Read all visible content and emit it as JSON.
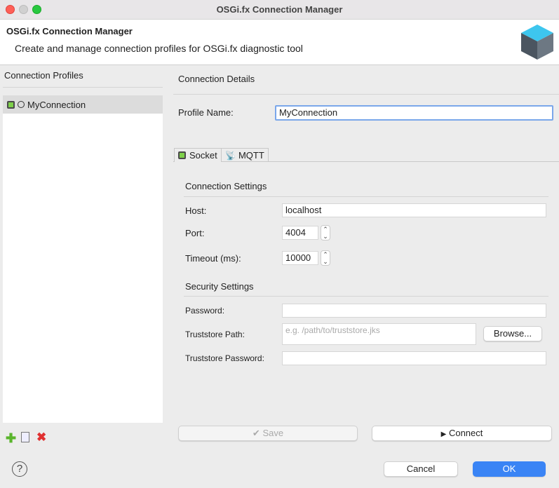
{
  "window": {
    "title": "OSGi.fx Connection Manager"
  },
  "banner": {
    "title": "OSGi.fx Connection Manager",
    "subtitle": "Create and manage connection profiles for OSGi.fx diagnostic tool"
  },
  "profiles": {
    "header": "Connection Profiles",
    "items": [
      {
        "label": "MyConnection"
      }
    ]
  },
  "details": {
    "header": "Connection Details",
    "profile_name_label": "Profile Name:",
    "profile_name_value": "MyConnection"
  },
  "tabs": [
    {
      "label": "Socket",
      "active": true
    },
    {
      "label": "MQTT",
      "active": false
    }
  ],
  "socket": {
    "connection_header": "Connection Settings",
    "host_label": "Host:",
    "host_value": "localhost",
    "port_label": "Port:",
    "port_value": "4004",
    "timeout_label": "Timeout (ms):",
    "timeout_value": "10000",
    "security_header": "Security Settings",
    "password_label": "Password:",
    "password_value": "",
    "truststore_label": "Truststore Path:",
    "truststore_placeholder": "e.g. /path/to/truststore.jks",
    "browse_label": "Browse...",
    "truststore_password_label": "Truststore Password:",
    "truststore_password_value": ""
  },
  "actions": {
    "save_label": "Save",
    "save_icon": "✔",
    "connect_label": "Connect",
    "connect_icon": "▶"
  },
  "footer": {
    "help_icon": "?",
    "cancel_label": "Cancel",
    "ok_label": "OK"
  },
  "colors": {
    "accent": "#3a84f5",
    "selection": "#dcdcdc"
  }
}
